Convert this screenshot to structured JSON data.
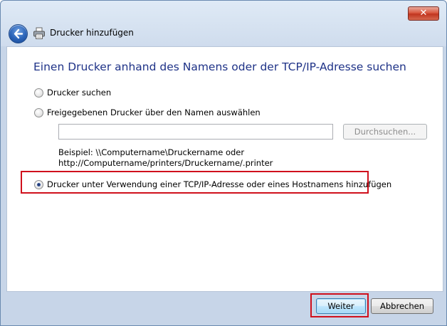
{
  "window": {
    "close_glyph": "✕"
  },
  "nav": {
    "title": "Drucker hinzufügen",
    "back_icon": "back-arrow-icon",
    "title_icon": "printer-icon"
  },
  "main": {
    "heading": "Einen Drucker anhand des Namens oder der TCP/IP-Adresse suchen",
    "options": [
      {
        "label": "Drucker suchen",
        "selected": false
      },
      {
        "label": "Freigegebenen Drucker über den Namen auswählen",
        "selected": false
      },
      {
        "label": "Drucker unter Verwendung einer TCP/IP-Adresse oder eines Hostnamens hinzufügen",
        "selected": true
      }
    ],
    "name_input": {
      "value": "",
      "placeholder": ""
    },
    "browse_label": "Durchsuchen...",
    "example_line1": "Beispiel: \\\\Computername\\Druckername oder",
    "example_line2": "http://Computername/printers/Druckername/.printer"
  },
  "footer": {
    "next_label": "Weiter",
    "cancel_label": "Abbrechen"
  },
  "colors": {
    "heading": "#1e3287",
    "highlight": "#d0101c",
    "close_button": "#c1351f"
  }
}
